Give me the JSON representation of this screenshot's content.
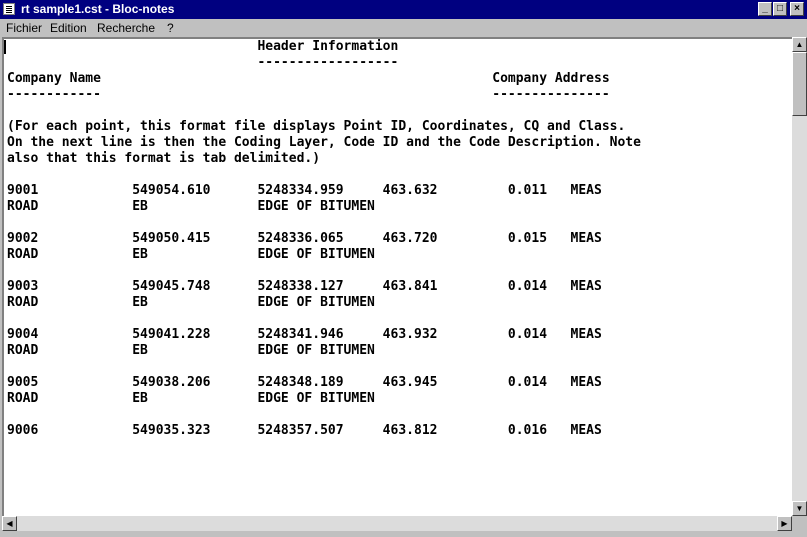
{
  "window": {
    "title": "rt sample1.cst - Bloc-notes",
    "controls": {
      "minimize": "_",
      "maximize": "□",
      "close": "×"
    }
  },
  "menu": {
    "file": "Fichier",
    "edit": "Edition",
    "search": "Recherche",
    "help": "?"
  },
  "document": {
    "lines": [
      "                                Header Information",
      "                                ------------------",
      "Company Name                                                  Company Address",
      "------------                                                  ---------------",
      "",
      "(For each point, this format file displays Point ID, Coordinates, CQ and Class.",
      "On the next line is then the Coding Layer, Code ID and the Code Description. Note",
      "also that this format is tab delimited.)",
      "",
      "9001            549054.610      5248334.959     463.632         0.011   MEAS",
      "ROAD            EB              EDGE OF BITUMEN",
      "",
      "9002            549050.415      5248336.065     463.720         0.015   MEAS",
      "ROAD            EB              EDGE OF BITUMEN",
      "",
      "9003            549045.748      5248338.127     463.841         0.014   MEAS",
      "ROAD            EB              EDGE OF BITUMEN",
      "",
      "9004            549041.228      5248341.946     463.932         0.014   MEAS",
      "ROAD            EB              EDGE OF BITUMEN",
      "",
      "9005            549038.206      5248348.189     463.945         0.014   MEAS",
      "ROAD            EB              EDGE OF BITUMEN",
      "",
      "9006            549035.323      5248357.507     463.812         0.016   MEAS"
    ]
  },
  "scrollbars": {
    "up": "▲",
    "down": "▼",
    "left": "◀",
    "right": "▶"
  }
}
